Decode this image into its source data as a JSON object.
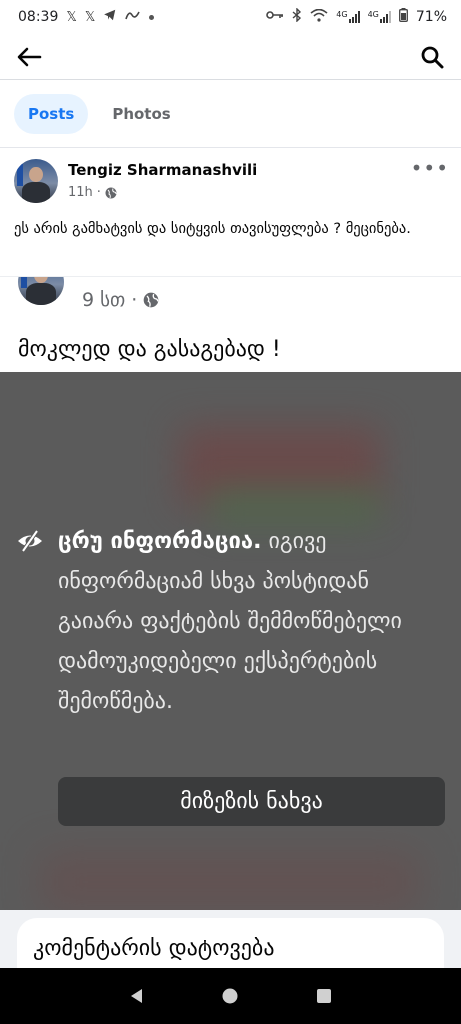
{
  "status_bar": {
    "time": "08:39",
    "battery": "71%",
    "network_labels": [
      "4G",
      "4G"
    ]
  },
  "tabs": [
    {
      "label": "Posts",
      "active": true
    },
    {
      "label": "Photos",
      "active": false
    }
  ],
  "post": {
    "author": "Tengiz Sharmanashvili",
    "time": "11h",
    "more": "•••",
    "text": "ეს არის გამხატვის და სიტყვის თავისუფლება ? მეცინება."
  },
  "shared_post": {
    "time": "9 სთ",
    "separator": "·",
    "text": "მოკლედ და გასაგებად !"
  },
  "fact_check": {
    "title": "ცრუ ინფორმაცია.",
    "body": "იგივე ინფორმაციამ სხვა პოსტიდან გაიარა ფაქტების შემმოწმებელი დამოუკიდებელი ექსპერტების შემოწმება.",
    "button": "მიზეზის ნახვა"
  },
  "comment": {
    "placeholder": "კომენტარის დატოვება"
  },
  "colors": {
    "accent": "#1877f2",
    "tab_active_bg": "#e7f3ff",
    "overlay_bg": "#5b5b5b",
    "button_bg": "#3a3b3c"
  },
  "icons": {
    "back": "arrow-left-icon",
    "search": "search-icon",
    "visibility": "eye-off-icon",
    "privacy": "globe-icon",
    "nav": [
      "back-triangle-icon",
      "home-circle-icon",
      "recents-square-icon"
    ]
  }
}
